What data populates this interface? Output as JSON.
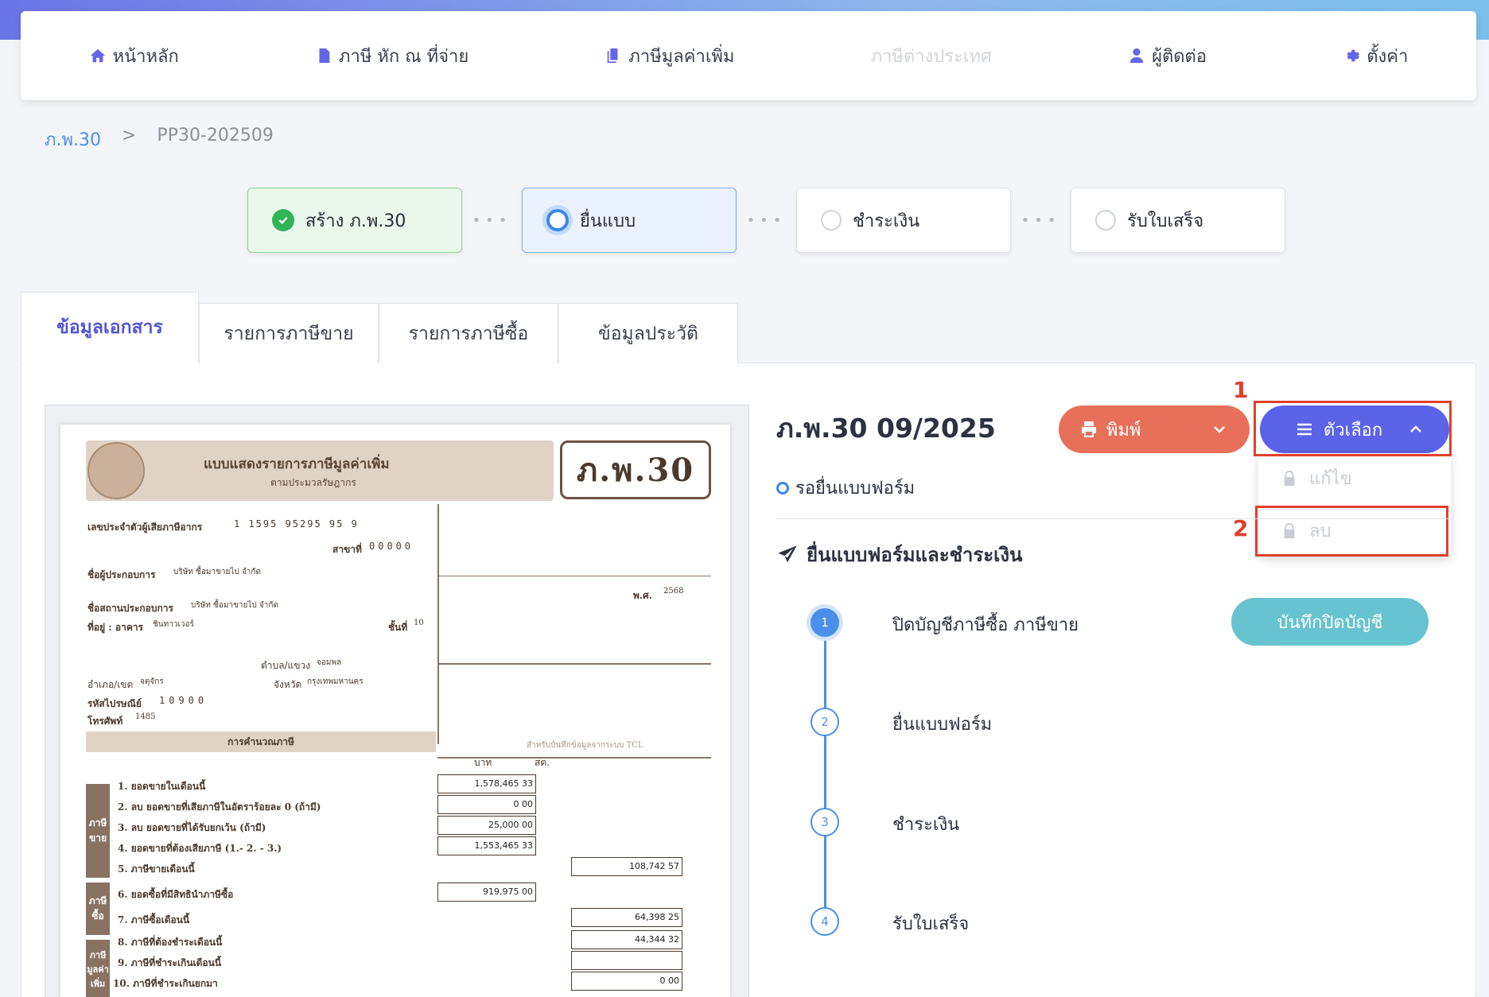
{
  "nav": {
    "home": "หน้าหลัก",
    "withholding": "ภาษี หัก ณ ที่จ่าย",
    "vat": "ภาษีมูลค่าเพิ่ม",
    "foreign": "ภาษีต่างประเทศ",
    "contacts": "ผู้ติดต่อ",
    "settings": "ตั้งค่า"
  },
  "breadcrumb": {
    "parent": "ภ.พ.30",
    "separator": ">",
    "current": "PP30-202509"
  },
  "stepper": [
    {
      "label": "สร้าง ภ.พ.30",
      "state": "done"
    },
    {
      "label": "ยื่นแบบ",
      "state": "active"
    },
    {
      "label": "ชำระเงิน",
      "state": "pending"
    },
    {
      "label": "รับใบเสร็จ",
      "state": "pending"
    }
  ],
  "tabs": [
    "ข้อมูลเอกสาร",
    "รายการภาษีขาย",
    "รายการภาษีซื้อ",
    "ข้อมูลประวัติ"
  ],
  "document": {
    "title": "ภ.พ.30 09/2025",
    "status": "รอยื่นแบบฟอร์ม",
    "print_label": "พิมพ์",
    "options_label": "ตัวเลือก",
    "options_menu": [
      "แก้ไข",
      "ลบ"
    ],
    "annotations": [
      "1",
      "2"
    ]
  },
  "filing": {
    "title": "ยื่นแบบฟอร์มและชำระเงิน",
    "steps": [
      {
        "num": "1",
        "label": "ปิดบัญชีภาษีซื้อ ภาษีขาย"
      },
      {
        "num": "2",
        "label": "ยื่นแบบฟอร์ม"
      },
      {
        "num": "3",
        "label": "ชำระเงิน"
      },
      {
        "num": "4",
        "label": "รับใบเสร็จ"
      }
    ],
    "close_book_button": "บันทึกปิดบัญชี"
  },
  "form": {
    "heading": "แบบแสดงรายการภาษีมูลค่าเพิ่ม",
    "subheading": "ตามประมวลรัษฎากร",
    "code": "ภ.พ.30",
    "taxid_label": "เลขประจำตัวผู้เสียภาษีอากร",
    "taxid": "1 1595 95295 95 9",
    "branch_label": "สาขาที่",
    "branch": "00000",
    "operator_label": "ชื่อผู้ประกอบการ",
    "operator": "บริษัท ซื้อมาขายไป จำกัด",
    "place_label": "ชื่อสถานประกอบการ",
    "place": "บริษัท ซื้อมาขายไป จำกัด",
    "address_label": "ที่อยู่ : อาคาร",
    "building": "ชินทาวเวอร์",
    "floor_label": "ชั้นที่",
    "floor": "10",
    "subdistrict_label": "ตำบล/แขวง",
    "subdistrict": "จอมพล",
    "district_label": "อำเภอ/เขต",
    "district": "จตุจักร",
    "province_label": "จังหวัด",
    "province": "กรุงเทพมหานคร",
    "postcode_label": "รหัสไปรษณีย์",
    "postcode": "10900",
    "phone_label": "โทรศัพท์",
    "phone": "1485",
    "year_label": "พ.ศ.",
    "year": "2568",
    "calc_band": "การคำนวณภาษี",
    "tcl_note": "สำหรับบันทึกข้อมูลจากระบบ TCL",
    "col_baht": "บาท",
    "col_satang": "สต.",
    "band_sales": "ภาษีขาย",
    "band_purchase": "ภาษีซื้อ",
    "band_vat": "ภาษีมูลค่าเพิ่ม",
    "lines": [
      {
        "label": "1. ยอดขายในเดือนนี้",
        "value": "1,578,465 33"
      },
      {
        "label": "2. ลบ ยอดขายที่เสียภาษีในอัตราร้อยละ 0 (ถ้ามี)",
        "value": "0 00"
      },
      {
        "label": "3. ลบ ยอดขายที่ได้รับยกเว้น (ถ้ามี)",
        "value": "25,000 00"
      },
      {
        "label": "4. ยอดขายที่ต้องเสียภาษี (1.- 2. - 3.)",
        "value": "1,553,465 33"
      },
      {
        "label": "5. ภาษีขายเดือนนี้",
        "value": "108,742 57"
      },
      {
        "label": "6. ยอดซื้อที่มีสิทธินำภาษีซื้อ",
        "value": "919,975 00"
      },
      {
        "label": "7. ภาษีซื้อเดือนนี้",
        "value": "64,398 25"
      },
      {
        "label": "8. ภาษีที่ต้องชำระเดือนนี้",
        "value": "44,344 32"
      },
      {
        "label": "9. ภาษีที่ชำระเกินเดือนนี้",
        "value": ""
      },
      {
        "label": "10. ภาษีที่ชำระเกินยกมา",
        "value": "0 00"
      }
    ]
  }
}
